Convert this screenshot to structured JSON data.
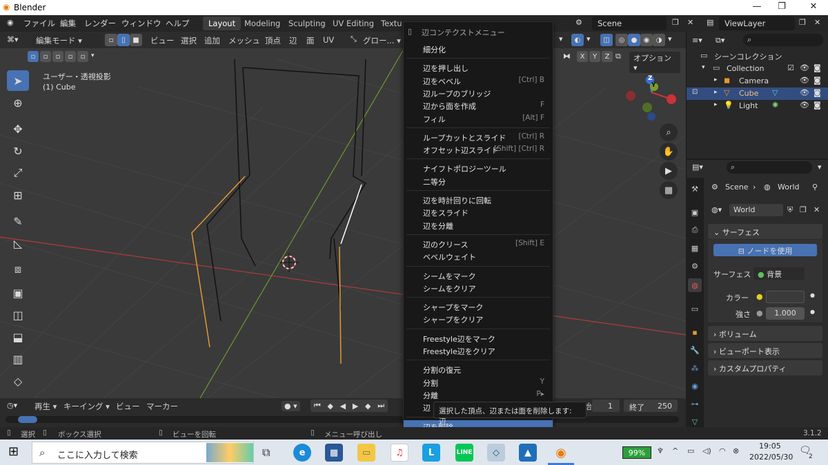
{
  "window": {
    "title": "Blender"
  },
  "menubar": {
    "items": [
      "ファイル",
      "編集",
      "レンダー",
      "ウィンドウ",
      "ヘルプ"
    ],
    "workspaces": [
      "Layout",
      "Modeling",
      "Sculpting",
      "UV Editing",
      "Textu"
    ],
    "scene": "Scene",
    "viewlayer": "ViewLayer"
  },
  "viewport": {
    "mode": "編集モード",
    "menus": [
      "ビュー",
      "選択",
      "追加",
      "メッシュ",
      "頂点",
      "辺",
      "面",
      "UV"
    ],
    "transform_orientation": "グロー...",
    "options_label": "オプション",
    "axes": [
      "X",
      "Y",
      "Z"
    ],
    "overlay_title": "ユーザー・透視投影",
    "overlay_object": "(1) Cube",
    "gizmo": {
      "x": "X",
      "y": "Y",
      "z": "Z"
    }
  },
  "context_menu": {
    "title": "辺コンテクストメニュー",
    "groups": [
      [
        {
          "label": "細分化",
          "shortcut": ""
        }
      ],
      [
        {
          "label": "辺を押し出し",
          "shortcut": ""
        },
        {
          "label": "辺をベベル",
          "shortcut": "[Ctrl] B"
        },
        {
          "label": "辺ループのブリッジ",
          "shortcut": ""
        },
        {
          "label": "辺から面を作成",
          "shortcut": "F"
        },
        {
          "label": "フィル",
          "shortcut": "[Alt] F"
        }
      ],
      [
        {
          "label": "ループカットとスライド",
          "shortcut": "[Ctrl] R"
        },
        {
          "label": "オフセット辺スライド",
          "shortcut": "[Shift] [Ctrl] R"
        }
      ],
      [
        {
          "label": "ナイフトポロジーツール",
          "shortcut": ""
        },
        {
          "label": "二等分",
          "shortcut": ""
        }
      ],
      [
        {
          "label": "辺を時計回りに回転",
          "shortcut": ""
        },
        {
          "label": "辺をスライド",
          "shortcut": ""
        },
        {
          "label": "辺を分離",
          "shortcut": ""
        }
      ],
      [
        {
          "label": "辺のクリース",
          "shortcut": "[Shift] E"
        },
        {
          "label": "ベベルウェイト",
          "shortcut": ""
        }
      ],
      [
        {
          "label": "シームをマーク",
          "shortcut": ""
        },
        {
          "label": "シームをクリア",
          "shortcut": ""
        }
      ],
      [
        {
          "label": "シャープをマーク",
          "shortcut": ""
        },
        {
          "label": "シャープをクリア",
          "shortcut": ""
        }
      ],
      [
        {
          "label": "Freestyle辺をマーク",
          "shortcut": ""
        },
        {
          "label": "Freestyle辺をクリア",
          "shortcut": ""
        }
      ],
      [
        {
          "label": "分割の復元",
          "shortcut": ""
        },
        {
          "label": "分割",
          "shortcut": "Y"
        },
        {
          "label": "分離",
          "shortcut": "P▸"
        },
        {
          "label": "辺",
          "shortcut": ""
        }
      ],
      [
        {
          "label": "辺を削除",
          "shortcut": ""
        }
      ]
    ]
  },
  "tooltip": "選択した頂点、辺または面を削除します: 辺",
  "timeline": {
    "menus": [
      "再生",
      "キーイング",
      "ビュー",
      "マーカー"
    ],
    "start_label": "始",
    "start": "1",
    "end_label": "終了",
    "end": "250"
  },
  "statusbar": {
    "items": [
      "選択",
      "ボックス選択",
      "ビューを回転",
      "メニュー呼び出し"
    ],
    "version": "3.1.2"
  },
  "outliner": {
    "scene_collection": "シーンコレクション",
    "rows": [
      {
        "name": "Collection",
        "depth": 1,
        "selected": false
      },
      {
        "name": "Camera",
        "depth": 2,
        "selected": false
      },
      {
        "name": "Cube",
        "depth": 2,
        "selected": true
      },
      {
        "name": "Light",
        "depth": 2,
        "selected": false
      }
    ]
  },
  "properties": {
    "breadcrumb_scene": "Scene",
    "breadcrumb_world": "World",
    "world_name": "World",
    "surface_panel": "サーフェス",
    "use_nodes": "ノードを使用",
    "surface_label": "サーフェス",
    "surface_value": "背景",
    "color_label": "カラー",
    "strength_label": "強さ",
    "strength_value": "1.000",
    "panels": [
      "ボリューム",
      "ビューポート表示",
      "カスタムプロパティ"
    ]
  },
  "taskbar": {
    "search_placeholder": "ここに入力して検索",
    "battery": "99%",
    "time": "19:05",
    "date": "2022/05/30",
    "notifications": "2"
  },
  "colors": {
    "accent": "#4772b3",
    "selected_edge": "#e39a2f",
    "x_axis": "#b43a3a",
    "y_axis": "#6d9a2e"
  }
}
